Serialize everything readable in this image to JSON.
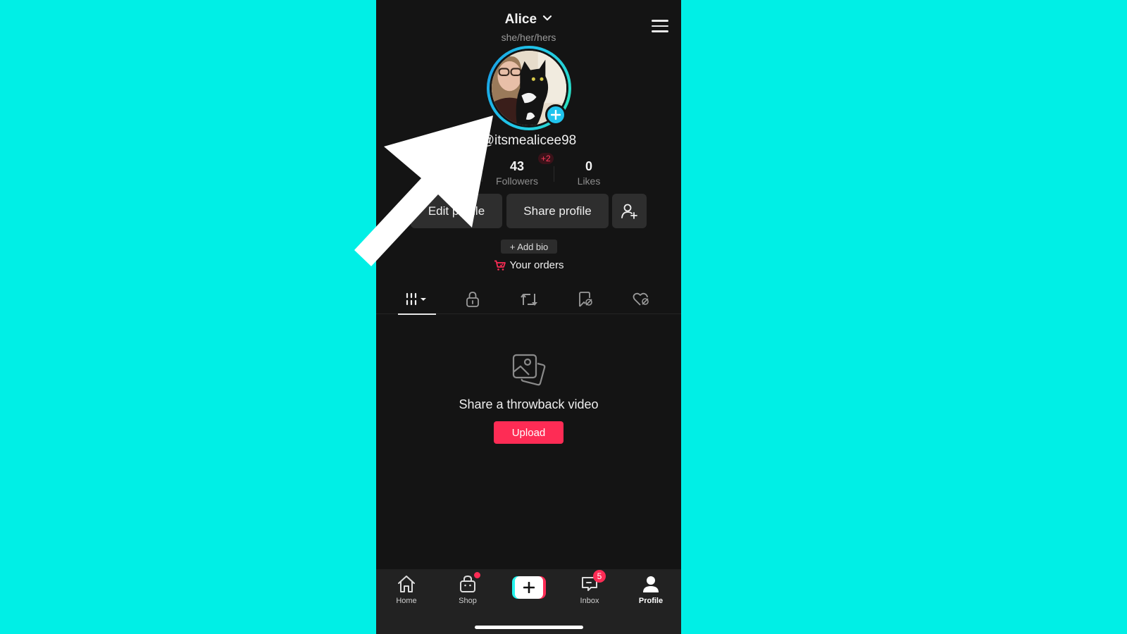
{
  "header": {
    "display_name": "Alice",
    "pronouns": "she/her/hers"
  },
  "profile": {
    "username": "@itsmealicee98",
    "username_visible": "itsmealicee98",
    "stats": {
      "followers": {
        "value": "43",
        "label": "Followers",
        "delta": "+2"
      },
      "likes": {
        "value": "0",
        "label": "Likes"
      }
    },
    "buttons": {
      "edit": "Edit profile",
      "share": "Share profile"
    },
    "add_bio": "+ Add bio",
    "orders": "Your orders"
  },
  "tabs": [
    {
      "name": "videos-grid",
      "active": true
    },
    {
      "name": "private",
      "active": false
    },
    {
      "name": "reposts",
      "active": false
    },
    {
      "name": "favorites",
      "active": false
    },
    {
      "name": "liked",
      "active": false
    }
  ],
  "empty_state": {
    "title": "Share a throwback video",
    "button": "Upload"
  },
  "bottom_nav": {
    "items": [
      {
        "label": "Home"
      },
      {
        "label": "Shop"
      },
      {
        "label": "Inbox",
        "badge": "5"
      },
      {
        "label": "Profile"
      }
    ]
  },
  "colors": {
    "background": "#00efe6",
    "accent_red": "#fe2c55",
    "accent_cyan": "#25f4ee",
    "avatar_ring": "#21c8e8"
  }
}
